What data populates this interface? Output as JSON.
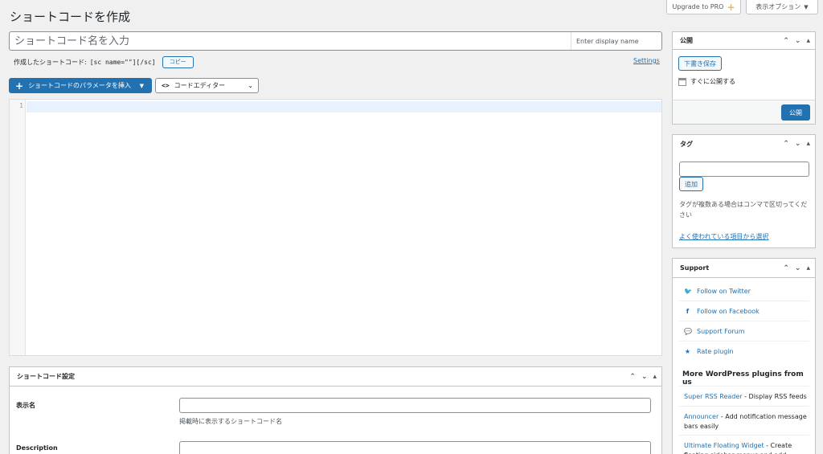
{
  "page": {
    "title": "ショートコードを作成"
  },
  "top": {
    "upgrade_label": "Upgrade to PRO",
    "upgrade_plus": "+",
    "screen_options_label": "表示オプション",
    "caret": "▼"
  },
  "title_field": {
    "placeholder": "ショートコード名を入力",
    "display_placeholder": "Enter display name"
  },
  "shortcode_row": {
    "label": "作成したショートコード:",
    "code": "[sc name=\"\"][/sc]",
    "copy_label": "コピー",
    "settings_link": "Settings"
  },
  "toolbar": {
    "plus": "+",
    "insert_label": "ショートコードのパラメータを挿入",
    "insert_caret": "▼",
    "code_glyph": "<>",
    "editor_label": "コードエディター",
    "editor_chevron": "⌄"
  },
  "editor": {
    "line_number": "1"
  },
  "settings_box": {
    "title": "ショートコード設定",
    "fields": [
      {
        "label": "表示名",
        "hint": "掲載時に表示するショートコード名"
      },
      {
        "label": "Description",
        "hint": ""
      }
    ]
  },
  "box_controls": {
    "up": "⌃",
    "down": "⌄",
    "toggle": "▴"
  },
  "publish": {
    "title": "公開",
    "draft_label": "下書き保存",
    "schedule_text": "すぐに公開する",
    "publish_label": "公開"
  },
  "tags": {
    "title": "タグ",
    "add_label": "追加",
    "help": "タグが複数ある場合はコンマで区切ってください",
    "popular_link": "よく使われている項目から選択"
  },
  "support": {
    "title": "Support",
    "items": [
      {
        "icon": "twitter-icon",
        "glyph": "🐦",
        "label": "Follow on Twitter"
      },
      {
        "icon": "facebook-icon",
        "glyph": "f",
        "label": "Follow on Facebook"
      },
      {
        "icon": "forum-icon",
        "glyph": "💬",
        "label": "Support Forum"
      },
      {
        "icon": "star-icon",
        "glyph": "★",
        "label": "Rate plugin"
      }
    ],
    "plugins_title": "More WordPress plugins from us",
    "plugins": [
      {
        "name": "Super RSS Reader",
        "desc": " - Display RSS feeds"
      },
      {
        "name": "Announcer",
        "desc": " - Add notification message bars easily"
      },
      {
        "name": "Ultimate Floating Widget",
        "desc": " - Create floating sidebar menus and add widgets"
      }
    ]
  },
  "colors": {
    "accent": "#2271b1",
    "background": "#f0f0f1",
    "pro": "#f0b849"
  }
}
